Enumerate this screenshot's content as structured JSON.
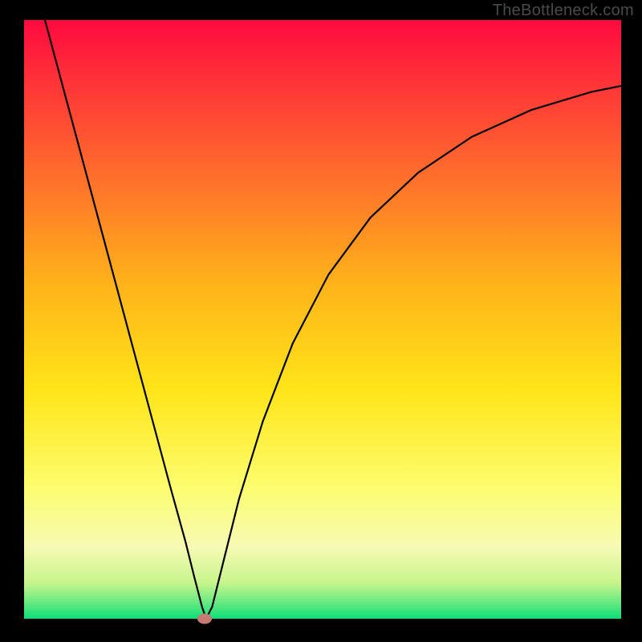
{
  "watermark_text": "TheBottleneck.com",
  "chart_data": {
    "type": "line",
    "title": "",
    "xlabel": "",
    "ylabel": "",
    "xlim": [
      0,
      100
    ],
    "ylim": [
      0,
      100
    ],
    "gradient_stops": [
      {
        "offset": 0.0,
        "color": "#ff0a3e"
      },
      {
        "offset": 0.08,
        "color": "#ff2a3a"
      },
      {
        "offset": 0.25,
        "color": "#ff6a2d"
      },
      {
        "offset": 0.45,
        "color": "#ffb619"
      },
      {
        "offset": 0.62,
        "color": "#ffe51a"
      },
      {
        "offset": 0.78,
        "color": "#fdfd6e"
      },
      {
        "offset": 0.88,
        "color": "#f7fab4"
      },
      {
        "offset": 0.94,
        "color": "#c8f58d"
      },
      {
        "offset": 0.975,
        "color": "#62e880"
      },
      {
        "offset": 1.0,
        "color": "#0adf78"
      }
    ],
    "curve": {
      "comment": "V-shaped bottleneck curve; x,y in [0,100] domain, y=0 bottom (green) best, y=100 top (red) worst",
      "points": [
        [
          3.5,
          100.0
        ],
        [
          7.0,
          87.0
        ],
        [
          10.5,
          74.0
        ],
        [
          14.0,
          61.0
        ],
        [
          17.5,
          48.0
        ],
        [
          21.0,
          35.0
        ],
        [
          24.5,
          22.0
        ],
        [
          27.0,
          13.0
        ],
        [
          28.5,
          7.0
        ],
        [
          29.8,
          2.0
        ],
        [
          30.5,
          0.0
        ],
        [
          31.5,
          2.0
        ],
        [
          33.0,
          8.0
        ],
        [
          36.0,
          20.0
        ],
        [
          40.0,
          33.0
        ],
        [
          45.0,
          46.0
        ],
        [
          51.0,
          57.5
        ],
        [
          58.0,
          67.0
        ],
        [
          66.0,
          74.5
        ],
        [
          75.0,
          80.5
        ],
        [
          85.0,
          85.0
        ],
        [
          95.0,
          88.0
        ],
        [
          100.0,
          89.0
        ]
      ]
    },
    "marker": {
      "x": 30.2,
      "y": 0.0,
      "color": "#c77a74"
    }
  }
}
